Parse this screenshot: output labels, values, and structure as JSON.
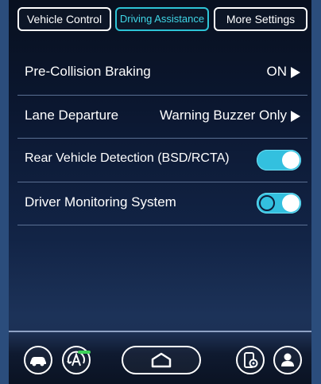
{
  "tabs": [
    {
      "label": "Vehicle Control",
      "active": false
    },
    {
      "label": "Driving Assistance",
      "active": true
    },
    {
      "label": "More Settings",
      "active": false
    }
  ],
  "settings": [
    {
      "label": "Pre-Collision Braking",
      "value": "ON",
      "type": "submenu"
    },
    {
      "label": "Lane Departure",
      "value": "Warning Buzzer Only",
      "type": "submenu"
    },
    {
      "label": "Rear Vehicle Detection (BSD/RCTA)",
      "type": "toggle",
      "state": "on"
    },
    {
      "label": "Driver Monitoring System",
      "type": "toggle",
      "state": "on"
    }
  ],
  "bottom_bar": {
    "icons": [
      "car-icon",
      "auto-a-icon",
      "home-icon",
      "phone-settings-icon",
      "user-icon"
    ]
  },
  "colors": {
    "accent": "#2ec4d6",
    "toggle_on": "#33c0df",
    "indicator": "#3fd35a"
  }
}
